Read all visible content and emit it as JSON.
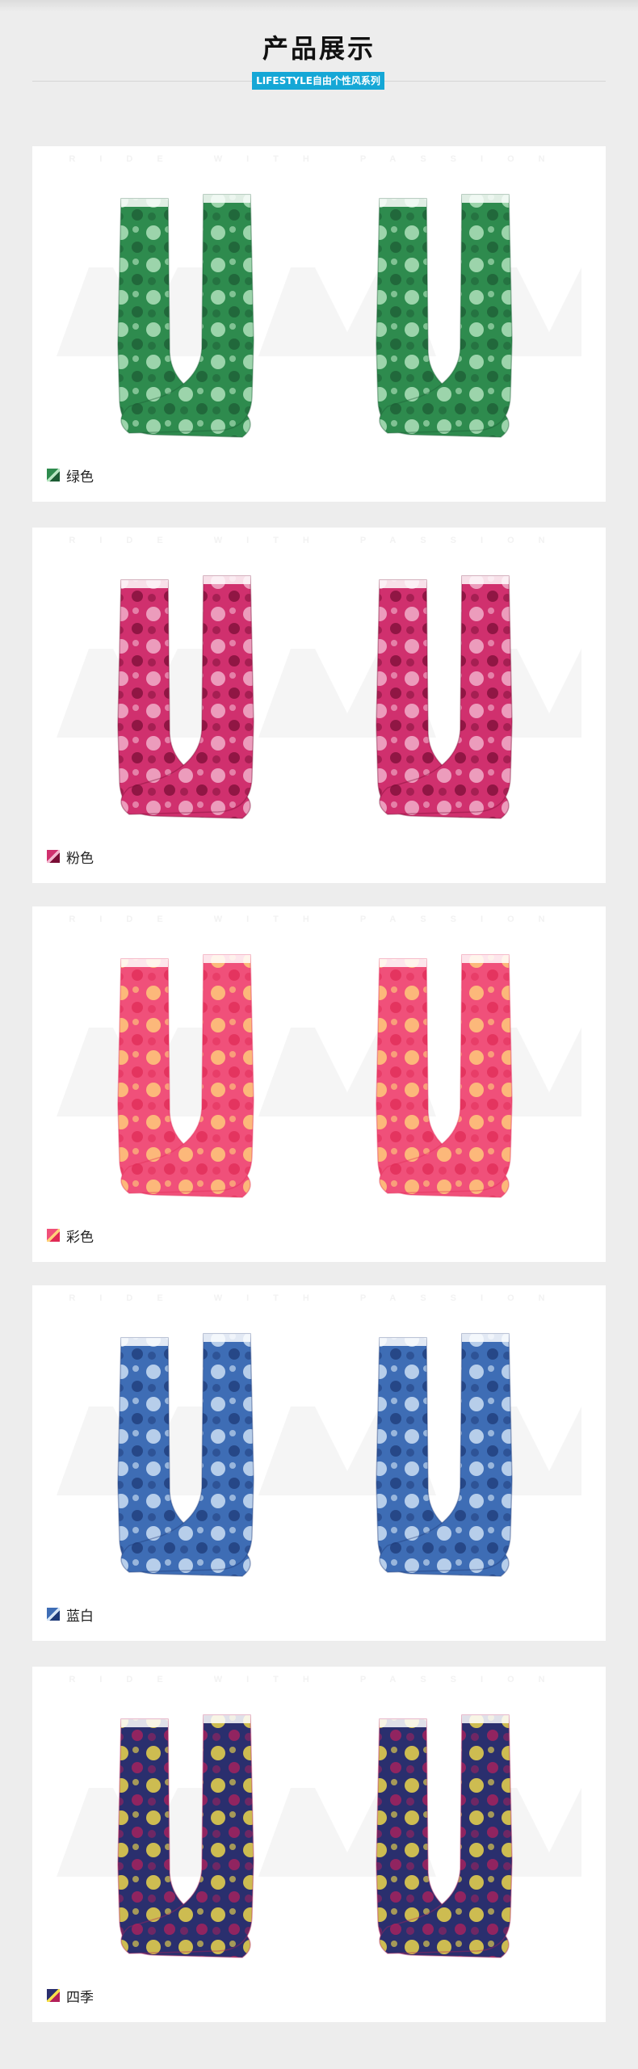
{
  "header": {
    "title": "产品展示",
    "subtitle": "LIFESTYLE自由个性风系列"
  },
  "watermark": "RIDE WITH PASSION",
  "products": [
    {
      "label": "绿色",
      "colors": {
        "base": "#2e8b4e",
        "light": "#b8e6c2",
        "dark": "#1c5c34"
      }
    },
    {
      "label": "粉色",
      "colors": {
        "base": "#d0306e",
        "light": "#f3b6cf",
        "dark": "#7a0d35"
      }
    },
    {
      "label": "彩色",
      "colors": {
        "base": "#f0507a",
        "light": "#ffd27a",
        "dark": "#e02a55"
      }
    },
    {
      "label": "蓝白",
      "colors": {
        "base": "#3e6db5",
        "light": "#d6e6f7",
        "dark": "#1d3a78"
      }
    },
    {
      "label": "四季",
      "colors": {
        "base": "#2a2f6e",
        "light": "#f6e04a",
        "dark": "#b3205a"
      }
    }
  ]
}
